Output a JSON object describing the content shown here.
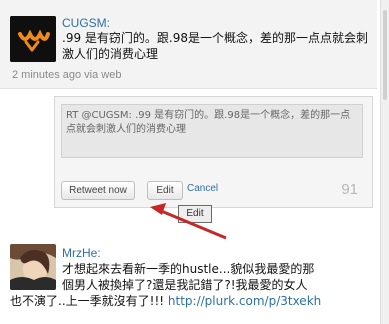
{
  "tweets": [
    {
      "username": "CUGSM:",
      "text": ".99 是有窃门的。跟.98是一个概念，差的那一点点就会刺激人们的消费心理",
      "meta": "2 minutes ago via web"
    },
    {
      "username": "MrzHe:",
      "text_line1": "才想起來去看新一季的hustle...貌似我最愛的那",
      "text_line2": "個男人被換掉了?還是我記錯了?!我最愛的女人",
      "text_line3": "也不演了..上一季就沒有了!!!",
      "link": "http://plurk.com/p/3txekh"
    }
  ],
  "retweet": {
    "textarea_value": "RT @CUGSM: .99 是有窃门的。跟.98是一个概念，差的那一点点就会刺激人们的消费心理",
    "retweet_now_label": "Retweet now",
    "edit_label": "Edit",
    "cancel_label": "Cancel",
    "char_count": "91"
  },
  "tooltip": {
    "label": "Edit"
  },
  "colors": {
    "link": "#2d6fa8",
    "arrow": "#c62828"
  }
}
